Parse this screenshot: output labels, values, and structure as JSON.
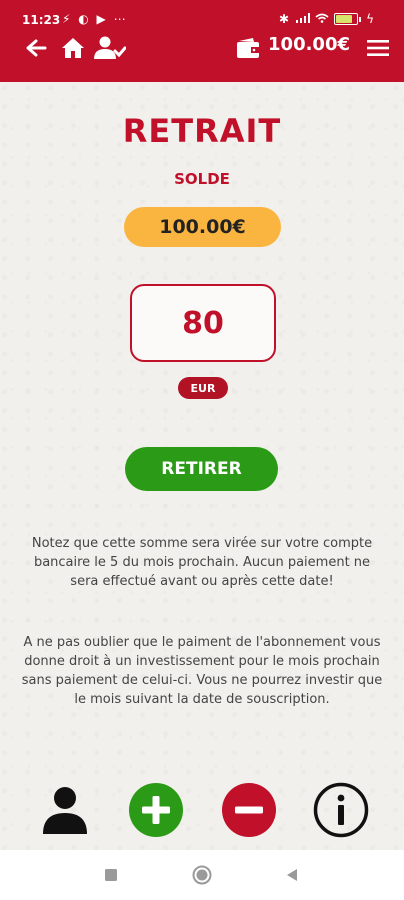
{
  "status_bar": {
    "time": "11:23",
    "left_icons": "⚡ ◐ ▶ ⋯"
  },
  "header": {
    "balance": "100.00€"
  },
  "main": {
    "title": "RETRAIT",
    "solde_label": "SOLDE",
    "solde_value": "100.00€",
    "amount_value": "80",
    "currency": "EUR",
    "withdraw_label": "RETIRER",
    "notice_1": "Notez que cette somme sera virée sur votre compte bancaire le 5 du mois prochain. Aucun paiement ne sera effectué avant ou après cette date!",
    "notice_2": "A ne pas oublier que le paiment de l'abonnement vous donne droit à un investissement pour le mois prochain sans paiement de celui-ci. Vous ne pourrez investir que le mois suivant la date de souscription."
  },
  "colors": {
    "brand_red": "#c1112a",
    "solde_pill": "#f9b540",
    "action_green": "#2b9a16"
  },
  "icons": {
    "header": [
      "back-arrow-icon",
      "home-icon",
      "user-check-icon",
      "wallet-icon",
      "menu-icon"
    ],
    "toolbar": [
      "profile-icon",
      "add-icon",
      "remove-icon",
      "info-icon"
    ],
    "system": [
      "recents-icon",
      "home-circle-icon",
      "back-triangle-icon"
    ]
  }
}
